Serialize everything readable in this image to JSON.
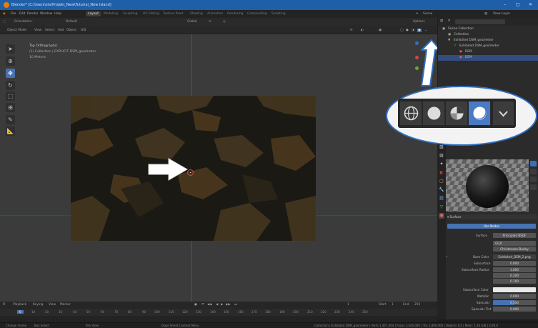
{
  "title_bar": {
    "title": "Blender* [C:\\Users\\stv\\Projekt_New\\Tutorial_New Island]",
    "controls": [
      "–",
      "□",
      "✕"
    ]
  },
  "menu": {
    "items": [
      "File",
      "Edit",
      "Render",
      "Window",
      "Help"
    ],
    "workspaces": [
      "Layout",
      "Modeling",
      "Sculpting",
      "UV Editing",
      "Texture Paint",
      "Shading",
      "Animation",
      "Rendering",
      "Compositing",
      "Scripting"
    ],
    "scene_label": "Scene",
    "view_layer_label": "View Layer"
  },
  "tool_header": {
    "orientation_label": "Orientation:",
    "orientation_value": "Default",
    "transform_label": "Global",
    "options_label": "Options"
  },
  "viewport_header": {
    "mode": "Object Mode",
    "menus": [
      "View",
      "Select",
      "Add",
      "Object",
      "GIS"
    ]
  },
  "viewport_overlay": {
    "view_name": "Top Orthographic",
    "collection_line": "(1) Collection | EXPLICIT DSM_geo/meter",
    "scale_line": "10 Meters"
  },
  "outliner": {
    "rows": [
      "Scene Collection",
      "Collection",
      "Exhibited DSM_geo/meter",
      "Exhibited DSM_geo/meter",
      "DEM",
      "DEM"
    ]
  },
  "properties": {
    "surface_section": "Surface",
    "use_nodes_label": "Use Nodes",
    "surface_label": "Surface",
    "surface_value": "Principled BSDF",
    "distribution_value": "GGX",
    "subsurface_method_value": "Christensen-Burley",
    "base_color_label": "Base Color",
    "base_color_value": "Exhibited_DEM_2.png",
    "subsurface_label": "Subsurface",
    "subsurface_value": "0.000",
    "subsurface_radius_label": "Subsurface Radius",
    "subsurface_radius_values": [
      "1.000",
      "0.200",
      "0.100"
    ],
    "subsurface_color_label": "Subsurface Color",
    "metallic_label": "Metallic",
    "metallic_value": "0.000",
    "specular_label": "Specular",
    "specular_value": "0.500",
    "specular_tint_label": "Specular Tint",
    "specular_tint_value": "0.000"
  },
  "timeline": {
    "menus": [
      "Playback",
      "Keying",
      "View",
      "Marker"
    ],
    "current_frame": "1",
    "start_label": "Start",
    "start_value": "1",
    "end_label": "End",
    "end_value": "250",
    "frame_ticks": [
      "0",
      "10",
      "20",
      "30",
      "40",
      "50",
      "60",
      "70",
      "80",
      "90",
      "100",
      "110",
      "120",
      "130",
      "140",
      "150",
      "160",
      "170",
      "180",
      "190",
      "200",
      "210",
      "220",
      "230",
      "240",
      "250"
    ]
  },
  "status_bar": {
    "items": [
      "Change Frame",
      "Box Select",
      "Pan View",
      "Dope Sheet Context Menu"
    ],
    "stats": "Collection | Exhibited DSM_geo/meter | Verts 1,447,404 | Faces 1,445,000 | Tris 2,890,000 | Objects 1/2 | Mem: 1.26 GiB | 2.90.0"
  },
  "callout": {
    "shading_buttons": [
      "wireframe",
      "solid",
      "material-preview",
      "rendered"
    ],
    "active": "rendered"
  },
  "colors": {
    "accent": "#4772b3",
    "callout_border": "#2f6fc0",
    "arrow": "#ffffff"
  }
}
